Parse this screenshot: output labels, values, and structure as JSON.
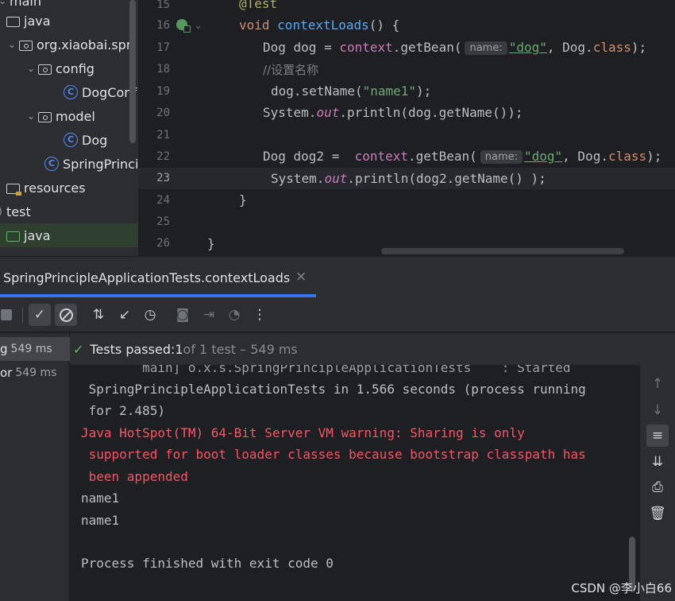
{
  "project_tree": {
    "items": [
      {
        "label": "main",
        "partial": true
      },
      {
        "label": "java"
      },
      {
        "label": "org.xiaobai.spri"
      },
      {
        "label": "config"
      },
      {
        "label": "DogConf"
      },
      {
        "label": "model"
      },
      {
        "label": "Dog"
      },
      {
        "label": "SpringPrinci"
      },
      {
        "label": "resources"
      },
      {
        "label": "test"
      },
      {
        "label": "java"
      }
    ]
  },
  "editor": {
    "line_numbers": [
      "15",
      "16",
      "17",
      "18",
      "19",
      "20",
      "21",
      "22",
      "23",
      "24",
      "25",
      "26"
    ],
    "current_line": "23",
    "hint_label": "name:",
    "code": {
      "l15_annotation": "@Test",
      "l16_void": "void ",
      "l16_method": "contextLoads",
      "l16_rest": "() {",
      "l17_a": "Dog dog = ",
      "l17_ctx": "context",
      "l17_b": ".getBean(",
      "l17_str": "\"dog\"",
      "l17_c": ", Dog.",
      "l17_class": "class",
      "l17_d": ");",
      "l18_comment": "//设置名称",
      "l19_a": "dog.setName(",
      "l19_str": "\"name1\"",
      "l19_b": ");",
      "l20_a": "System.",
      "l20_out": "out",
      "l20_b": ".println(dog.getName());",
      "l22_a": "Dog dog2 =  ",
      "l22_ctx": "context",
      "l22_b": ".getBean(",
      "l22_str": "\"dog\"",
      "l22_c": ", Dog.",
      "l22_class": "class",
      "l22_d": ");",
      "l23_a": "System.",
      "l23_out": "out",
      "l23_b": ".println(dog2.getName() );",
      "l24": "}",
      "l26": "}"
    }
  },
  "run_tab": {
    "title": "SpringPrincipleApplicationTests.contextLoads",
    "close_glyph": "×"
  },
  "toolbar": {
    "icons": [
      "stop-icon",
      "show-passed-icon",
      "show-ignored-icon",
      "sort-icon",
      "import-tests-icon",
      "history-icon",
      "screenshot-icon",
      "export-icon",
      "coverage-icon",
      "more-icon"
    ]
  },
  "tests_list": {
    "rows": [
      {
        "label": "g",
        "time": "549 ms"
      },
      {
        "label": "or",
        "time": "549 ms"
      }
    ]
  },
  "status": {
    "prefix": "Tests passed: ",
    "passed": "1",
    "suffix": " of 1 test – 549 ms"
  },
  "console": {
    "lines": [
      {
        "text": "        main] o.x.s.SpringPrincipleApplicationTests    : Started",
        "partial": true
      },
      {
        "text": " SpringPrincipleApplicationTests in 1.566 seconds (process running"
      },
      {
        "text": " for 2.485)"
      },
      {
        "text": "Java HotSpot(TM) 64-Bit Server VM warning: Sharing is only",
        "color": "#f75464"
      },
      {
        "text": " supported for boot loader classes because bootstrap classpath has",
        "color": "#f75464"
      },
      {
        "text": " been appended",
        "color": "#f75464"
      },
      {
        "text": "name1"
      },
      {
        "text": "name1"
      },
      {
        "text": ""
      },
      {
        "text": "Process finished with exit code 0"
      }
    ]
  },
  "watermark": "CSDN @李小白66",
  "colors": {
    "accent": "#3574f0",
    "pass_green": "#5fb865",
    "error_red": "#f75464"
  }
}
